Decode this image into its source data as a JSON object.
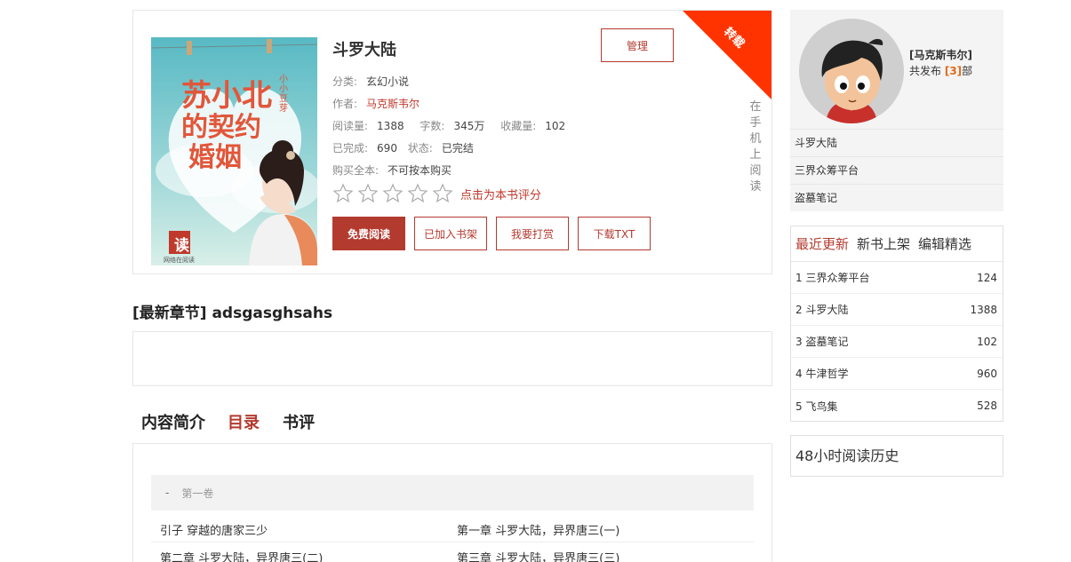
{
  "book": {
    "title": "斗罗大陆",
    "manage_label": "管理",
    "ribbon_label": "转载",
    "mobile_label": "在手机上阅读",
    "category_label": "分类:",
    "category": "玄幻小说",
    "author_label": "作者:",
    "author": "马克斯韦尔",
    "reads_label": "阅读量:",
    "reads": "1388",
    "words_label": "字数:",
    "words": "345万",
    "favs_label": "收藏量:",
    "favs": "102",
    "finished_label": "已完成:",
    "finished": "690",
    "status_label": "状态:",
    "status": "已完结",
    "buy_label": "购买全本:",
    "buy": "不可按本购买",
    "rate_label": "点击为本书评分",
    "rating": 0,
    "rating_max": 5,
    "buttons": {
      "read": "免费阅读",
      "shelf": "已加入书架",
      "tip": "我要打赏",
      "download": "下载TXT"
    },
    "cover": {
      "title_lines": [
        "苏小北",
        "的契约",
        "婚姻"
      ],
      "author": "小小豆芽",
      "publisher": "网络在阅读",
      "seal": "读"
    }
  },
  "latest": {
    "label": "[最新章节] adsgasghsahs"
  },
  "tabs": [
    {
      "label": "内容简介"
    },
    {
      "label": "目录"
    },
    {
      "label": "书评"
    }
  ],
  "catalog": {
    "volume_dash": "-",
    "volume": "第一卷",
    "chapters": [
      "引子 穿越的唐家三少",
      "第一章 斗罗大陆，异界唐三(一)",
      "第二章 斗罗大陆，异界唐三(二)",
      "第三章 斗罗大陆，异界唐三(三)"
    ]
  },
  "author_panel": {
    "name": "[马克斯韦尔]",
    "count_prefix": "共发布",
    "count": "[3]",
    "count_suffix": "部",
    "books": [
      "斗罗大陆",
      "三界众筹平台",
      "盗墓笔记"
    ]
  },
  "ranking": {
    "tabs": [
      "最近更新",
      "新书上架",
      "编辑精选"
    ],
    "rows": [
      {
        "rank": "1",
        "name": "三界众筹平台",
        "value": "124"
      },
      {
        "rank": "2",
        "name": "斗罗大陆",
        "value": "1388"
      },
      {
        "rank": "3",
        "name": "盗墓笔记",
        "value": "102"
      },
      {
        "rank": "4",
        "name": "牛津哲学",
        "value": "960"
      },
      {
        "rank": "5",
        "name": "飞鸟集",
        "value": "528"
      }
    ]
  },
  "history": {
    "label": "48小时阅读历史"
  },
  "colors": {
    "accent": "#b33a2f",
    "ribbon": "#ff3300",
    "count": "#e06a1a"
  }
}
